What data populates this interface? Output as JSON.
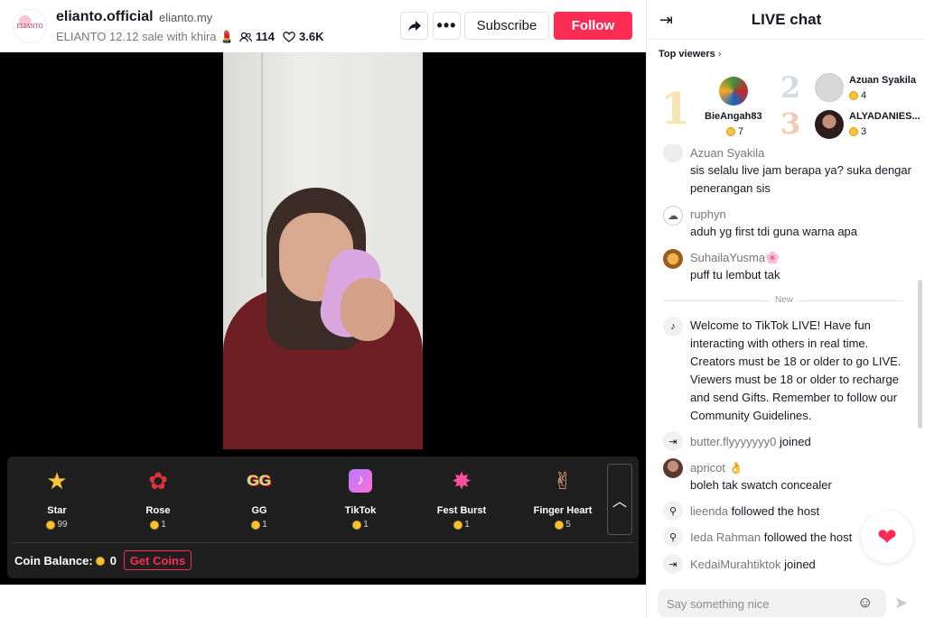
{
  "header": {
    "display_name": "elianto.official",
    "handle": "elianto.my",
    "live_title": "ELIANTO 12.12 sale with khira 💄",
    "viewers": "114",
    "likes": "3.6K",
    "subscribe_label": "Subscribe",
    "follow_label": "Follow",
    "avatar_text": "ELIANTO"
  },
  "gifts": {
    "items": [
      {
        "name": "Star",
        "price": "99",
        "icon": "⭐"
      },
      {
        "name": "Rose",
        "price": "1",
        "icon": "🌹"
      },
      {
        "name": "GG",
        "price": "1",
        "icon": "GG"
      },
      {
        "name": "TikTok",
        "price": "1",
        "icon": "♪"
      },
      {
        "name": "Fest Burst",
        "price": "1",
        "icon": "✸"
      },
      {
        "name": "Finger Heart",
        "price": "5",
        "icon": "🫰"
      }
    ],
    "coin_balance_label": "Coin Balance:",
    "coin_balance_value": "0",
    "get_coins_label": "Get Coins"
  },
  "chat": {
    "title": "LIVE chat",
    "top_viewers_label": "Top viewers",
    "top_viewers": [
      {
        "rank": "1",
        "name": "BieAngah83",
        "coins": "7"
      },
      {
        "rank": "2",
        "name": "Azuan Syakila",
        "coins": "4"
      },
      {
        "rank": "3",
        "name": "ALYADANIES...",
        "coins": "3"
      }
    ],
    "messages": [
      {
        "user": "Azuan Syakila",
        "text": "sis selalu live jam berapa ya? suka dengar penerangan sis"
      },
      {
        "user": "ruphyn",
        "text": "aduh yg first tdi guna warna apa"
      },
      {
        "user": "SuhailaYusma🌸",
        "text": "puff tu lembut tak"
      }
    ],
    "new_label": "New",
    "welcome_text": "Welcome to TikTok LIVE! Have fun interacting with others in real time. Creators must be 18 or older to go LIVE. Viewers must be 18 or older to recharge and send Gifts. Remember to follow our Community Guidelines.",
    "apricot_user": "apricot 👌",
    "apricot_text": "boleh tak swatch concealer",
    "events": [
      {
        "user": "butter.flyyyyyyy0",
        "action": "joined"
      },
      {
        "user": "lieenda",
        "action": "followed the host"
      },
      {
        "user": "Ieda Rahman",
        "action": "followed the host"
      },
      {
        "user": "KedaiMurahtiktok",
        "action": "joined"
      }
    ],
    "input_placeholder": "Say something nice"
  },
  "colors": {
    "accent": "#fe2c55",
    "gift_panel": "#1f1f1f",
    "coin": "#f8c23a"
  }
}
